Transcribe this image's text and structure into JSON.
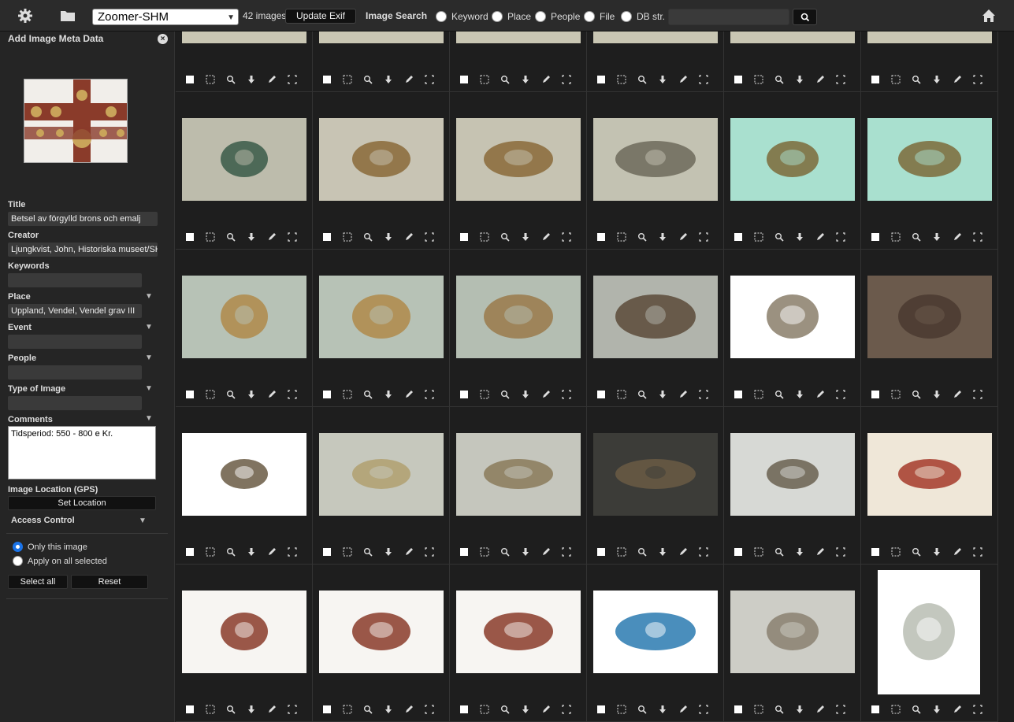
{
  "toolbar": {
    "catalog": "Zoomer-SHM",
    "image_count": "42 images",
    "update_exif": "Update Exif",
    "image_search": "Image Search",
    "search_options": [
      "Keyword",
      "Place",
      "People",
      "File",
      "DB str."
    ],
    "search_value": ""
  },
  "panel": {
    "title": "Add Image Meta Data",
    "title_label": "Title",
    "title_value": "Betsel av förgylld brons och emalj",
    "creator_label": "Creator",
    "creator_value": "Ljungkvist, John, Historiska museet/SH",
    "keywords_label": "Keywords",
    "keywords_value": "",
    "place_label": "Place",
    "place_value": "Uppland, Vendel, Vendel grav III",
    "event_label": "Event",
    "people_label": "People",
    "type_label": "Type of Image",
    "comments_label": "Comments",
    "comments_value": "Tidsperiod: 550 - 800 e Kr.",
    "gps_label": "Image Location (GPS)",
    "set_location": "Set Location",
    "access_label": "Access Control",
    "only_this": "Only this image",
    "apply_all": "Apply on all selected",
    "select_all": "Select all",
    "reset": "Reset"
  },
  "icons": [
    "gear-icon",
    "folder-icon",
    "home-icon",
    "search-icon",
    "checkbox-icon",
    "select-icon",
    "zoom-icon",
    "download-icon",
    "edit-icon",
    "crop-icon"
  ],
  "colors": {
    "accent": "#1a73e8",
    "background": "#1e1e1e",
    "panel": "#252525"
  }
}
